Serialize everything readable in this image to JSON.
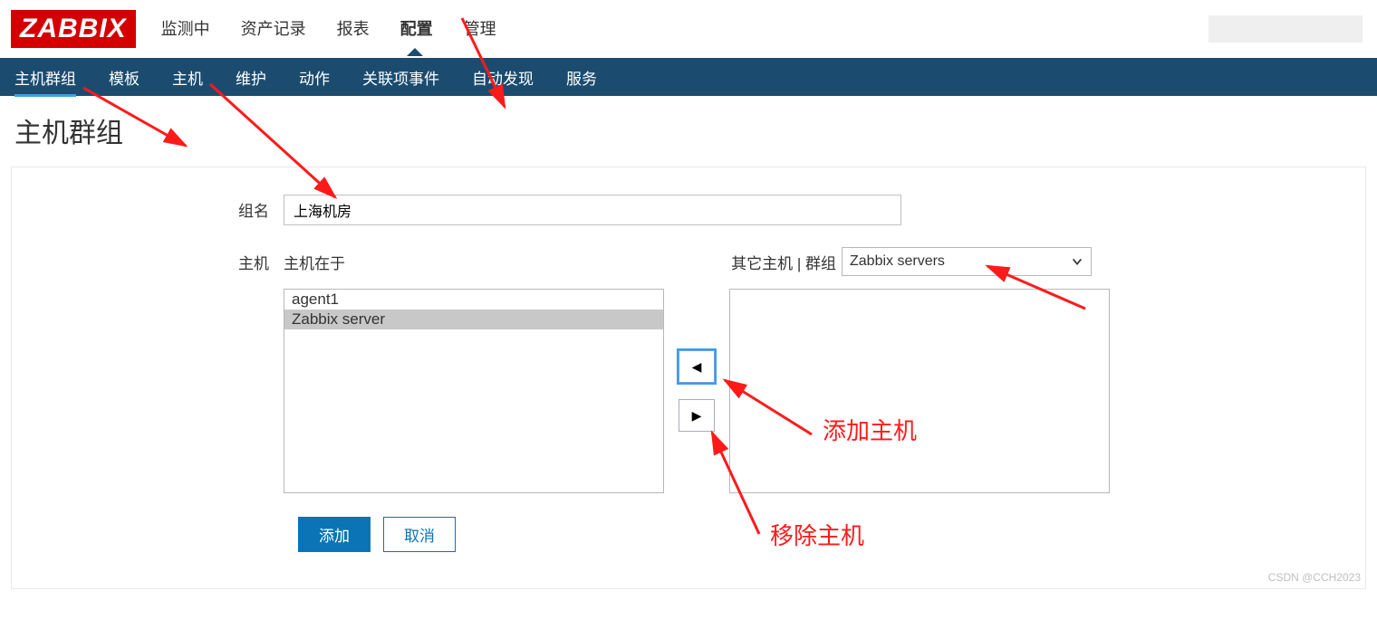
{
  "logo": "ZABBIX",
  "main_nav": {
    "items": [
      {
        "label": "监测中"
      },
      {
        "label": "资产记录"
      },
      {
        "label": "报表"
      },
      {
        "label": "配置",
        "active": true
      },
      {
        "label": "管理"
      }
    ]
  },
  "sub_nav": {
    "items": [
      {
        "label": "主机群组",
        "active": true
      },
      {
        "label": "模板"
      },
      {
        "label": "主机"
      },
      {
        "label": "维护"
      },
      {
        "label": "动作"
      },
      {
        "label": "关联项事件"
      },
      {
        "label": "自动发现"
      },
      {
        "label": "服务"
      }
    ]
  },
  "page": {
    "title": "主机群组"
  },
  "form": {
    "group_name_label": "组名",
    "group_name_value": "上海机房",
    "hosts_label": "主机",
    "hosts_in_label": "主机在于",
    "other_hosts_label": "其它主机 | 群组",
    "group_select_value": "Zabbix servers",
    "left_list": [
      {
        "label": "agent1",
        "selected": false
      },
      {
        "label": "Zabbix server",
        "selected": true
      }
    ],
    "right_list": [],
    "arrow_left": "◀",
    "arrow_right": "▶",
    "add_button": "添加",
    "cancel_button": "取消"
  },
  "annotations": {
    "add_host": "添加主机",
    "remove_host": "移除主机"
  },
  "watermark": "CSDN @CCH2023"
}
